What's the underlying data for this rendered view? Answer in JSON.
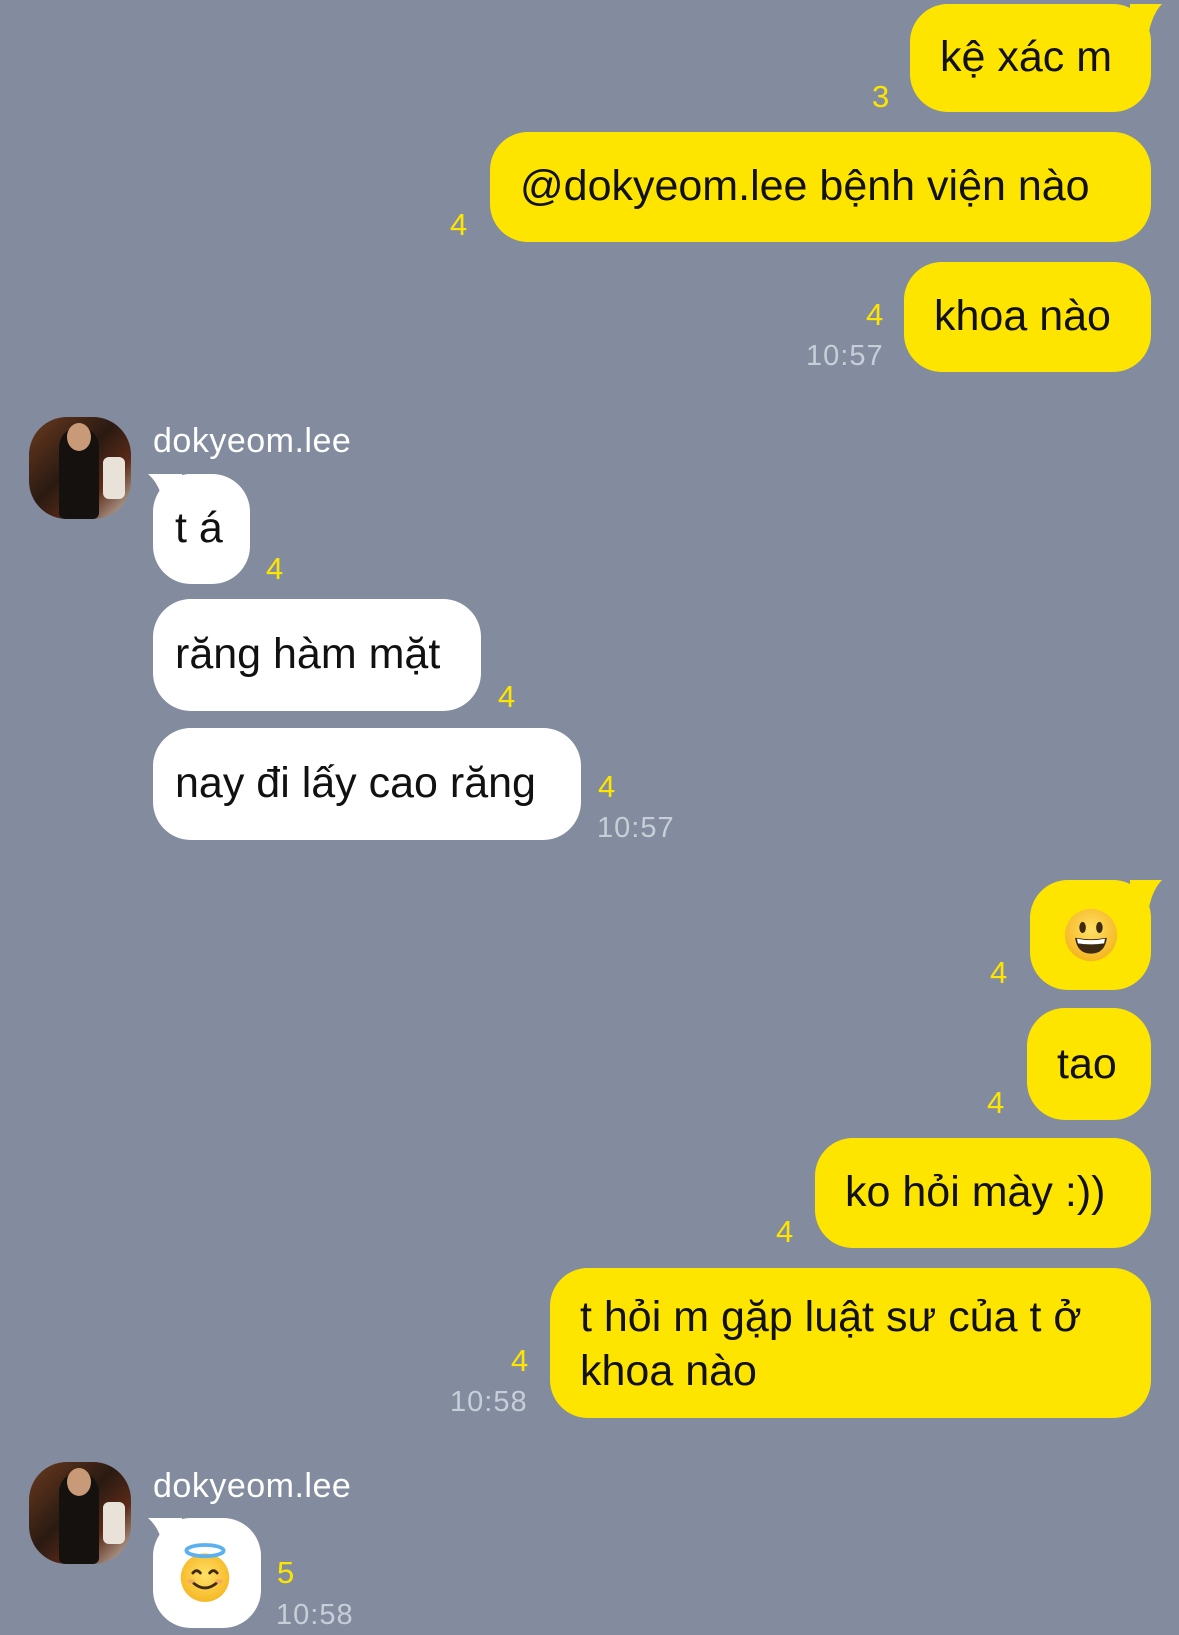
{
  "colors": {
    "background": "#828c9e",
    "outgoing_bubble": "#fee500",
    "incoming_bubble": "#ffffff",
    "unread_count": "#fee500",
    "timestamp": "#c8ced8"
  },
  "messages": {
    "m1": {
      "text": "kệ xác m",
      "unread": "3"
    },
    "m2": {
      "text": "@dokyeom.lee bệnh viện nào",
      "unread": "4"
    },
    "m3": {
      "text": "khoa nào",
      "unread": "4",
      "time": "10:57"
    },
    "sender1": {
      "name": "dokyeom.lee"
    },
    "m4": {
      "text": "t á",
      "unread": "4"
    },
    "m5": {
      "text": "răng hàm mặt",
      "unread": "4"
    },
    "m6": {
      "text": "nay đi lấy cao răng",
      "unread": "4",
      "time": "10:57"
    },
    "m7": {
      "emoji": "grinning-face-icon",
      "unread": "4"
    },
    "m8": {
      "text": "tao",
      "unread": "4"
    },
    "m9": {
      "text": "ko hỏi mày :))",
      "unread": "4"
    },
    "m10": {
      "line1": "t hỏi m gặp luật sư của t ở",
      "line2": "khoa nào",
      "unread": "4",
      "time": "10:58"
    },
    "sender2": {
      "name": "dokyeom.lee"
    },
    "m11": {
      "emoji": "smiling-face-with-halo-icon",
      "unread": "5",
      "time": "10:58"
    }
  }
}
